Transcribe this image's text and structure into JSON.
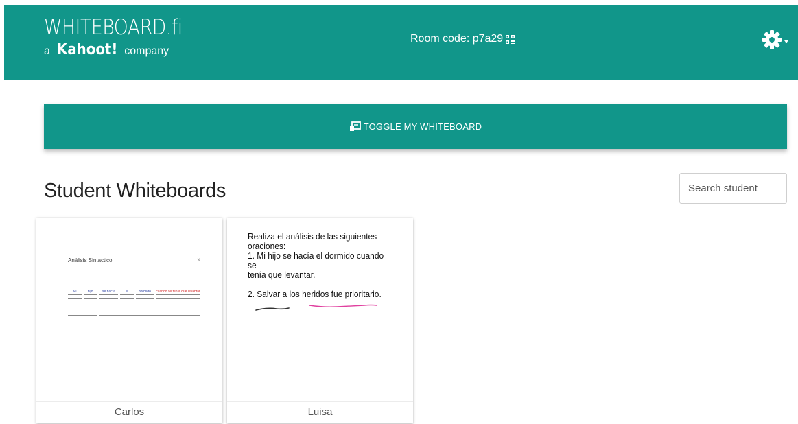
{
  "header": {
    "logo_main": "WHITEBOARD.fi",
    "logo_prefix": "a",
    "logo_brand": "Kahoot!",
    "logo_suffix": "company",
    "room_code_label": "Room code: p7a29",
    "qr_icon": "qr-code-icon",
    "settings_icon": "gear-icon"
  },
  "toolbar": {
    "toggle_label": "TOGGLE MY WHITEBOARD",
    "toggle_icon": "whiteboard-icon"
  },
  "section": {
    "title": "Student Whiteboards",
    "search_placeholder": "Search student"
  },
  "students": [
    {
      "name": "Carlos",
      "thumbnail": {
        "title": "Análisis Sintactico",
        "close": "x",
        "words": [
          "Mi",
          "hijo",
          "se hacía",
          "el",
          "dormido",
          "cuando se tenía que levantar"
        ]
      }
    },
    {
      "name": "Luisa",
      "thumbnail": {
        "lines": [
          "Realiza el análisis de las siguientes",
          "oraciones:",
          "1. Mi hijo se hacía el dormido cuando se",
          "tenía que levantar.",
          "2. Salvar a los heridos fue prioritario."
        ]
      }
    }
  ],
  "colors": {
    "brand_teal": "#11968a",
    "ink_pink": "#e0409f"
  }
}
